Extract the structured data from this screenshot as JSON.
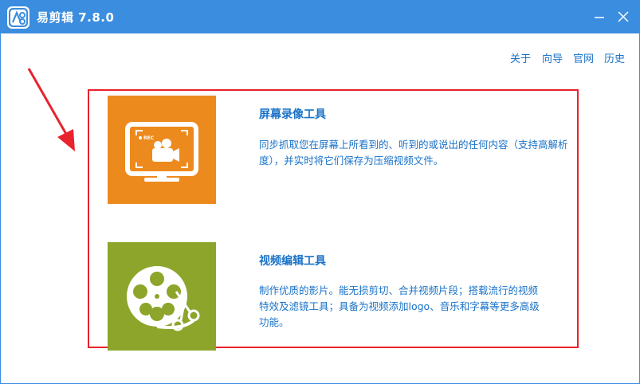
{
  "window": {
    "title": "易剪辑 7.8.0",
    "minimize_glyph": "—",
    "close_glyph": "✕"
  },
  "nav": {
    "about": "关于",
    "guide": "向导",
    "website": "官网",
    "history": "历史"
  },
  "tools": [
    {
      "icon": "screen-recorder-icon",
      "title": "屏幕录像工具",
      "description": "同步抓取您在屏幕上所看到的、听到的或说出的任何内容（支持高解析度），并实时将它们保存为压缩视频文件。",
      "icon_badge": "REC",
      "color": "#ed8a1e"
    },
    {
      "icon": "video-editor-icon",
      "title": "视频编辑工具",
      "description": "制作优质的影片。能无损剪切、合并视频片段；搭载流行的视频特效及滤镜工具；具备为视频添加logo、音乐和字幕等更多高级功能。",
      "color": "#8ca52a"
    }
  ],
  "colors": {
    "titlebar": "#3b8de0",
    "link": "#1a73c8",
    "highlight": "#e8232d"
  }
}
